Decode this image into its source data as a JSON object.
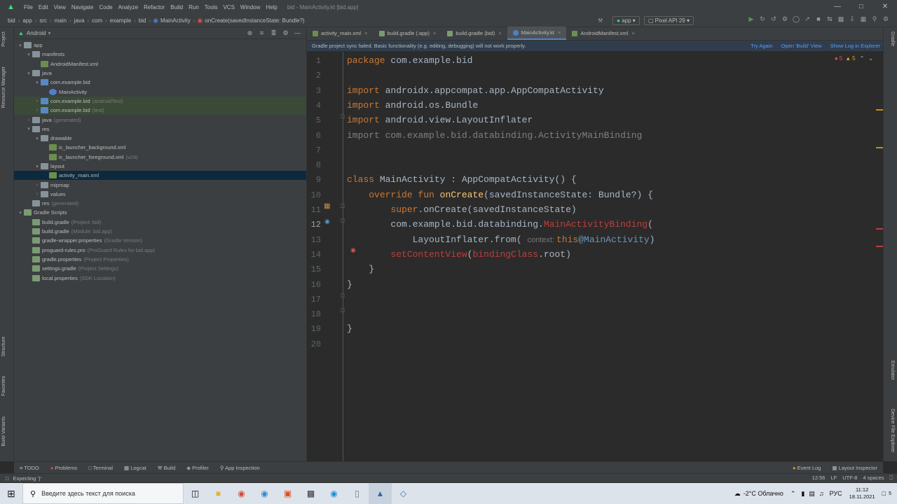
{
  "menubar": {
    "items": [
      "File",
      "Edit",
      "View",
      "Navigate",
      "Code",
      "Analyze",
      "Refactor",
      "Build",
      "Run",
      "Tools",
      "VCS",
      "Window",
      "Help"
    ],
    "title": "bid - MainActivity.kt [bid.app]"
  },
  "navbar": {
    "crumbs": [
      "bid",
      "app",
      "src",
      "main",
      "java",
      "com",
      "example",
      "bid",
      "MainActivity",
      "onCreate(savedInstanceState: Bundle?)"
    ],
    "module": "app",
    "device": "Pixel API 29"
  },
  "left_strip": {
    "project": "Project",
    "resource_manager": "Resource Manager",
    "structure": "Structure",
    "favorites": "Favorites",
    "build_variants": "Build Variants"
  },
  "right_strip": {
    "gradle": "Gradle",
    "emulator": "Emulator",
    "device_file_explorer": "Device File Explorer"
  },
  "project": {
    "view": "Android",
    "tree": [
      {
        "label": "app",
        "sub": "",
        "depth": 0,
        "arrow": "open",
        "icon": "folder"
      },
      {
        "label": "manifests",
        "sub": "",
        "depth": 1,
        "arrow": "open",
        "icon": "folder"
      },
      {
        "label": "AndroidManifest.xml",
        "sub": "",
        "depth": 2,
        "arrow": "",
        "icon": "xml"
      },
      {
        "label": "java",
        "sub": "",
        "depth": 1,
        "arrow": "open",
        "icon": "folder"
      },
      {
        "label": "com.example.bid",
        "sub": "",
        "depth": 2,
        "arrow": "open",
        "icon": "folder"
      },
      {
        "label": "MainActivity",
        "sub": "",
        "depth": 3,
        "arrow": "",
        "icon": "kt"
      },
      {
        "label": "com.example.bid",
        "sub": "(androidTest)",
        "depth": 2,
        "arrow": "closed",
        "icon": "folder",
        "hl": true
      },
      {
        "label": "com.example.bid",
        "sub": "(test)",
        "depth": 2,
        "arrow": "closed",
        "icon": "folder",
        "hl": true
      },
      {
        "label": "java",
        "sub": "(generated)",
        "depth": 1,
        "arrow": "closed",
        "icon": "folder"
      },
      {
        "label": "res",
        "sub": "",
        "depth": 1,
        "arrow": "open",
        "icon": "folder"
      },
      {
        "label": "drawable",
        "sub": "",
        "depth": 2,
        "arrow": "open",
        "icon": "folder"
      },
      {
        "label": "ic_launcher_background.xml",
        "sub": "",
        "depth": 3,
        "arrow": "",
        "icon": "xml"
      },
      {
        "label": "ic_launcher_foreground.xml",
        "sub": "(v24)",
        "depth": 3,
        "arrow": "",
        "icon": "xml"
      },
      {
        "label": "layout",
        "sub": "",
        "depth": 2,
        "arrow": "open",
        "icon": "folder"
      },
      {
        "label": "activity_main.xml",
        "sub": "",
        "depth": 3,
        "arrow": "",
        "icon": "xml",
        "sel": true
      },
      {
        "label": "mipmap",
        "sub": "",
        "depth": 2,
        "arrow": "closed",
        "icon": "folder"
      },
      {
        "label": "values",
        "sub": "",
        "depth": 2,
        "arrow": "closed",
        "icon": "folder"
      },
      {
        "label": "res",
        "sub": "(generated)",
        "depth": 1,
        "arrow": "",
        "icon": "folder"
      },
      {
        "label": "Gradle Scripts",
        "sub": "",
        "depth": 0,
        "arrow": "open",
        "icon": "gr"
      },
      {
        "label": "build.gradle",
        "sub": "(Project: bid)",
        "depth": 1,
        "arrow": "",
        "icon": "gr"
      },
      {
        "label": "build.gradle",
        "sub": "(Module: bid.app)",
        "depth": 1,
        "arrow": "",
        "icon": "gr"
      },
      {
        "label": "gradle-wrapper.properties",
        "sub": "(Gradle Version)",
        "depth": 1,
        "arrow": "",
        "icon": "gr"
      },
      {
        "label": "proguard-rules.pro",
        "sub": "(ProGuard Rules for bid.app)",
        "depth": 1,
        "arrow": "",
        "icon": "gr"
      },
      {
        "label": "gradle.properties",
        "sub": "(Project Properties)",
        "depth": 1,
        "arrow": "",
        "icon": "gr"
      },
      {
        "label": "settings.gradle",
        "sub": "(Project Settings)",
        "depth": 1,
        "arrow": "",
        "icon": "gr"
      },
      {
        "label": "local.properties",
        "sub": "(SDK Location)",
        "depth": 1,
        "arrow": "",
        "icon": "gr"
      }
    ]
  },
  "editor": {
    "tabs": [
      {
        "label": "activity_main.xml",
        "icon": "xml",
        "active": false
      },
      {
        "label": "build.gradle (:app)",
        "icon": "gr",
        "active": false
      },
      {
        "label": "build.gradle (bid)",
        "icon": "gr",
        "active": false
      },
      {
        "label": "MainActivity.kt",
        "icon": "kt",
        "active": true
      },
      {
        "label": "AndroidManifest.xml",
        "icon": "xml",
        "active": false
      }
    ],
    "banner": {
      "message": "Gradle project sync failed. Basic functionality (e.g. editing, debugging) will not work properly.",
      "try_again": "Try Again",
      "open_build": "Open 'Build' View",
      "show_log": "Show Log in Explorer"
    },
    "inspections": {
      "errors": "5",
      "warnings": "5"
    },
    "current_line": 12,
    "lines": [
      [
        [
          "kw",
          "package "
        ],
        [
          "",
          "com.example.bid"
        ]
      ],
      [],
      [
        [
          "kw",
          "import "
        ],
        [
          "",
          "androidx.appcompat.app.AppCompatActivity"
        ]
      ],
      [
        [
          "kw",
          "import "
        ],
        [
          "",
          "android.os.Bundle"
        ]
      ],
      [
        [
          "kw",
          "import "
        ],
        [
          "",
          "android.view.LayoutInflater"
        ]
      ],
      [
        [
          "cm",
          "import com.example.bid.databinding.ActivityMainBinding"
        ]
      ],
      [],
      [],
      [
        [
          "kw",
          "class "
        ],
        [
          "",
          "MainActivity : AppCompatActivity() {"
        ]
      ],
      [
        [
          "",
          "    "
        ],
        [
          "kw",
          "override fun "
        ],
        [
          "fn",
          "onCreate"
        ],
        [
          "",
          "(savedInstanceState: Bundle?) {"
        ]
      ],
      [
        [
          "",
          "        "
        ],
        [
          "kw",
          "super"
        ],
        [
          "",
          ".onCreate(savedInstanceState)"
        ]
      ],
      [
        [
          "",
          "        com.example.bid.databinding."
        ],
        [
          "err",
          "MainActivityBinding"
        ],
        [
          "",
          "("
        ]
      ],
      [
        [
          "",
          "            LayoutInflater.from( "
        ],
        [
          "hint",
          "context: "
        ],
        [
          "kw",
          "this"
        ],
        [
          "lbl",
          "@MainActivity"
        ],
        [
          "",
          ")"
        ]
      ],
      [
        [
          "",
          "        "
        ],
        [
          "err",
          "setContentView"
        ],
        [
          "",
          "("
        ],
        [
          "err",
          "bindingClass"
        ],
        [
          "",
          ".root)"
        ]
      ],
      [
        [
          "",
          "    }"
        ]
      ],
      [
        [
          "",
          "}"
        ]
      ],
      [],
      [],
      [
        [
          "",
          "}"
        ]
      ],
      []
    ]
  },
  "bottom_tabs": {
    "left": [
      "TODO",
      "Problems",
      "Terminal",
      "Logcat",
      "Build",
      "Profiler",
      "App Inspection"
    ],
    "right": [
      "Event Log",
      "Layout Inspector"
    ]
  },
  "statusbar": {
    "message": "Expecting ')'",
    "position": "12:56",
    "line_sep": "LF",
    "encoding": "UTF-8",
    "indent": "4 spaces"
  },
  "taskbar": {
    "search_placeholder": "Введите здесь текст для поиска",
    "weather": "-2°C Облачно",
    "lang": "РУС",
    "time": "11:12",
    "date": "18.11.2021",
    "notifications": "5"
  }
}
